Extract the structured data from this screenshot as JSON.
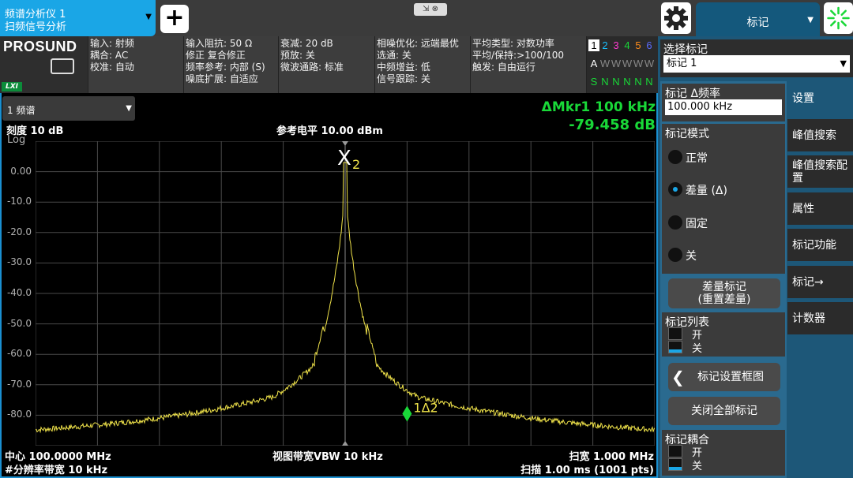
{
  "topbar": {
    "instrument_line1": "频谱分析仪 1",
    "instrument_line2": "扫频信号分析",
    "add_label": "+",
    "ctrl_label": "⇲ ⊗",
    "menu_title": "标记"
  },
  "brand": {
    "name": "PROSUND",
    "lxi": "LXI"
  },
  "settings": {
    "col1": [
      "输入: 射频",
      "耦合: AC",
      "校准: 自动"
    ],
    "col2": [
      "输入阻抗: 50 Ω",
      "修正 复合修正",
      "频率参考: 内部 (S)",
      "噪底扩展: 自适应"
    ],
    "col3": [
      "衰减: 20 dB",
      "预放: 关",
      "微波通路: 标准"
    ],
    "col4": [
      "相噪优化: 远端最优",
      "选通: 关",
      "中频增益: 低",
      "信号跟踪: 关"
    ],
    "col5": [
      "平均类型: 对数功率",
      "平均/保持:>100/100",
      "触发: 自由运行"
    ]
  },
  "traces": {
    "numbers": [
      "1",
      "2",
      "3",
      "4",
      "5",
      "6"
    ],
    "number_colors": [
      "#f2e000",
      "#19c0ff",
      "#ff3ad0",
      "#19d838",
      "#ff8c1a",
      "#5a6bff"
    ],
    "type_row": [
      "A",
      "W",
      "W",
      "W",
      "W",
      "W"
    ],
    "det_row": [
      "S",
      "N",
      "N",
      "N",
      "N",
      "N"
    ]
  },
  "plot": {
    "trace_selector": "1 频谱",
    "scale_label": "刻度 10 dB",
    "scale_type": "Log",
    "ref_level": "参考电平 10.00 dBm",
    "marker_delta_freq": "ΔMkr1  100 kHz",
    "marker_delta_amp": "-79.458 dB",
    "y_ticks": [
      "0.00",
      "-10.0",
      "-20.0",
      "-30.0",
      "-40.0",
      "-50.0",
      "-60.0",
      "-70.0",
      "-80.0"
    ],
    "center": "中心 100.0000 MHz",
    "rbw": "#分辨率带宽 10 kHz",
    "vbw": "视图带宽VBW 10 kHz",
    "span": "扫宽 1.000 MHz",
    "sweep": "扫描 1.00 ms (1001 pts)",
    "ref_marker_label": "X",
    "ref_marker_index": "2",
    "delta_marker_label": "1Δ2",
    "trace_color": "#f0e34a",
    "marker_color": "#19d838"
  },
  "right_panel": {
    "select_title": "选择标记",
    "select_value": "标记 1",
    "delta_freq_title": "标记 Δ频率",
    "delta_freq_value": "100.000 kHz",
    "mode_title": "标记模式",
    "modes": [
      "正常",
      "差量 (Δ)",
      "固定",
      "关"
    ],
    "selected_mode": "差量 (Δ)",
    "delta_btn_line1": "差量标记",
    "delta_btn_line2": "(重置差量)",
    "list_title": "标记列表",
    "on": "开",
    "off": "关",
    "setup_btn": "标记设置框图",
    "all_off_btn": "关闭全部标记",
    "coupling_title": "标记耦合",
    "menu": [
      "设置",
      "峰值搜索",
      "峰值搜索配置",
      "属性",
      "标记功能",
      "标记→",
      "计数器"
    ]
  }
}
